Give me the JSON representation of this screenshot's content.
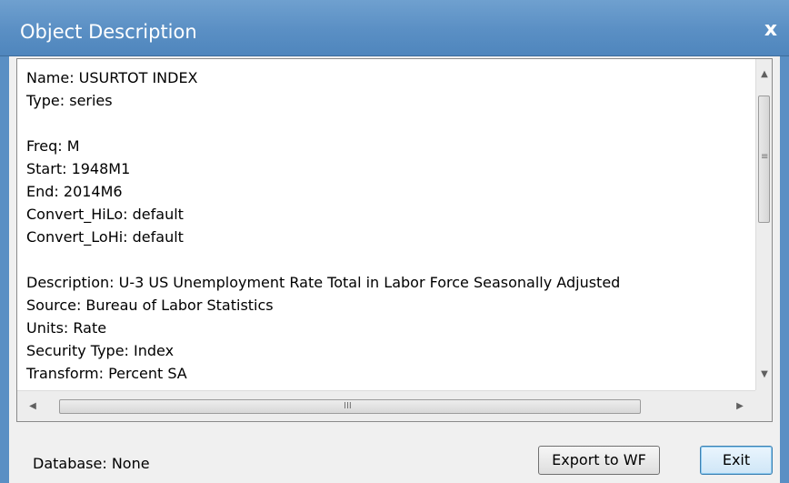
{
  "window": {
    "title": "Object Description",
    "close_label": "x"
  },
  "description": {
    "lines": [
      "Name: USURTOT INDEX",
      "Type: series",
      "",
      "Freq: M",
      "Start: 1948M1",
      "End: 2014M6",
      "Convert_HiLo: default",
      "Convert_LoHi: default",
      "",
      "Description: U-3 US Unemployment Rate Total in Labor Force Seasonally Adjusted",
      "Source: Bureau of Labor Statistics",
      "Units: Rate",
      "Security Type: Index",
      "Transform: Percent SA"
    ]
  },
  "scrollbars": {
    "up_arrow": "▲",
    "down_arrow": "▼",
    "left_arrow": "◀",
    "right_arrow": "▶",
    "v_grip": "≡",
    "h_grip": "III"
  },
  "footer": {
    "database_label": "Database: None",
    "export_button": "Export to WF",
    "exit_button": "Exit"
  }
}
